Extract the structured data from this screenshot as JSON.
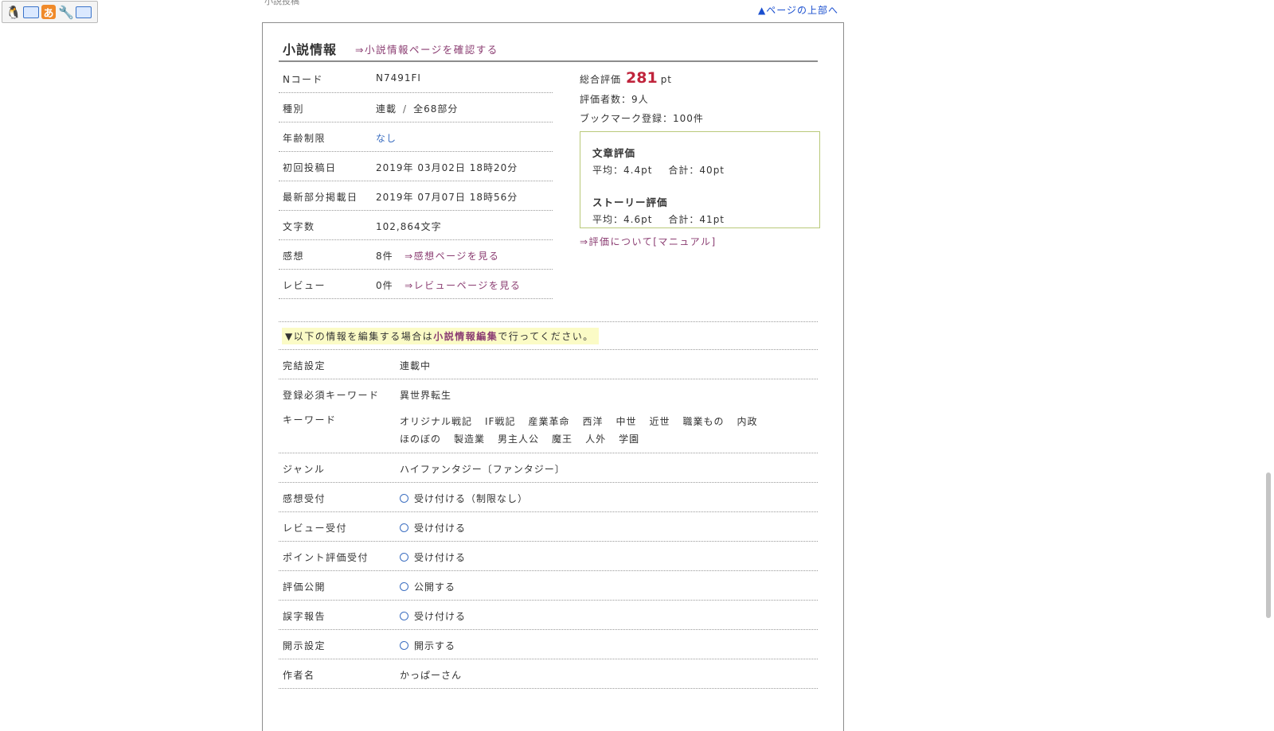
{
  "top": {
    "cut_text": "小説投稿",
    "page_top_link": "▲ページの上部へ"
  },
  "header": {
    "title": "小説情報",
    "link": "⇒小説情報ページを確認する"
  },
  "info": [
    {
      "label": "Nコード",
      "value": "N7491FI"
    },
    {
      "label": "種別",
      "value": "連載",
      "sep": "/",
      "value2": "全68部分"
    },
    {
      "label": "年齢制限",
      "value": "なし"
    },
    {
      "label": "初回投稿日",
      "value": "2019年 03月02日 18時20分"
    },
    {
      "label": "最新部分掲載日",
      "value": "2019年 07月07日 18時56分"
    },
    {
      "label": "文字数",
      "value": "102,864文字"
    },
    {
      "label": "感想",
      "value": "8件",
      "link": "⇒感想ページを見る"
    },
    {
      "label": "レビュー",
      "value": "0件",
      "link": "⇒レビューページを見る"
    }
  ],
  "rating": {
    "total_label": "総合評価",
    "total_points": "281",
    "unit": "pt",
    "raters": "評価者数：9人",
    "bookmarks": "ブックマーク登録：100件",
    "writing_title": "文章評価",
    "writing_avg": "平均：4.4pt",
    "writing_sum": "合計：40pt",
    "story_title": "ストーリー評価",
    "story_avg": "平均：4.6pt",
    "story_sum": "合計：41pt",
    "manual_link": "⇒評価について[マニュアル]"
  },
  "notice": {
    "prefix": "▼以下の情報を編集する場合は",
    "emphasis": "小説情報編集",
    "suffix": "で行ってください。"
  },
  "settings": {
    "completion_label": "完結設定",
    "completion": "連載中",
    "required_kw_label": "登録必須キーワード",
    "required_kw": "異世界転生",
    "keywords_label": "キーワード",
    "keywords": [
      "オリジナル戦記",
      "IF戦記",
      "産業革命",
      "西洋",
      "中世",
      "近世",
      "職業もの",
      "内政",
      "ほのぼの",
      "製造業",
      "男主人公",
      "魔王",
      "人外",
      "学園"
    ],
    "genre_label": "ジャンル",
    "genre": "ハイファンタジー〔ファンタジー〕",
    "impressions_label": "感想受付",
    "impressions": "受け付ける（制限なし）",
    "reviews_label": "レビュー受付",
    "reviews": "受け付ける",
    "points_label": "ポイント評価受付",
    "points": "受け付ける",
    "public_label": "評価公開",
    "public": "公開する",
    "typo_label": "誤字報告",
    "typo": "受け付ける",
    "disclose_label": "開示設定",
    "disclose": "開示する",
    "author_label": "作者名",
    "author": "かっぱーさん"
  }
}
